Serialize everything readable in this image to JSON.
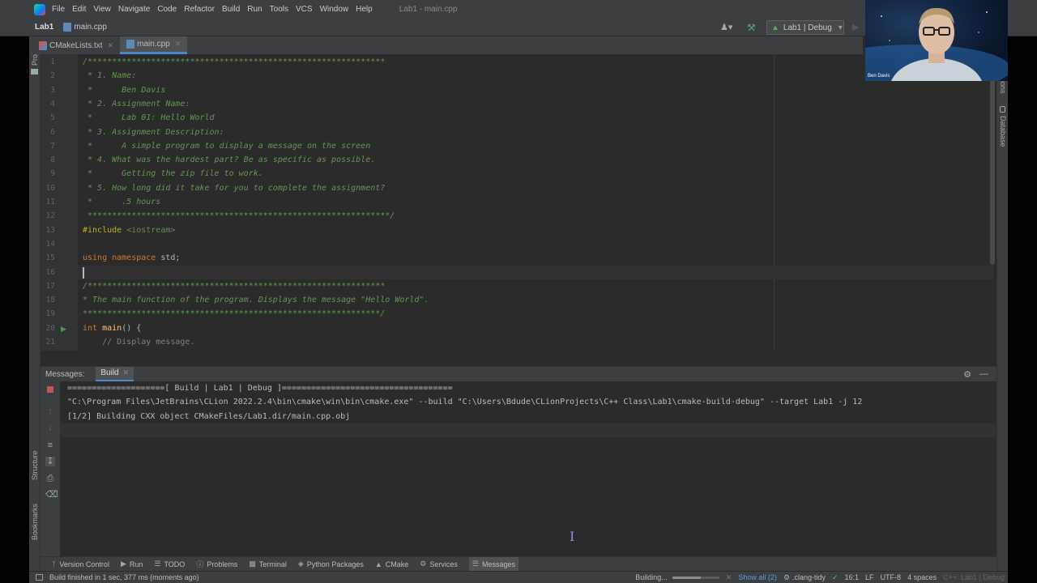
{
  "menubar": {
    "items": [
      "File",
      "Edit",
      "View",
      "Navigate",
      "Code",
      "Refactor",
      "Build",
      "Run",
      "Tools",
      "VCS",
      "Window",
      "Help"
    ],
    "window_title": "Lab1 - main.cpp"
  },
  "navbar": {
    "project": "Lab1",
    "file": "main.cpp"
  },
  "run_config": {
    "label": "Lab1 | Debug"
  },
  "tabs": [
    {
      "label": "CMakeLists.txt"
    },
    {
      "label": "main.cpp",
      "active": true
    }
  ],
  "left_stripe": {
    "project": "Project",
    "structure": "Structure",
    "bookmarks": "Bookmarks"
  },
  "right_stripe": {
    "notifications": "ions",
    "database": "Database"
  },
  "webcam": {
    "name": "Ben Davis"
  },
  "editor": {
    "lines": [
      {
        "n": "1",
        "tokens": [
          {
            "t": "/*************************************************************",
            "c": "cmt"
          }
        ]
      },
      {
        "n": "2",
        "tokens": [
          {
            "t": " * 1. Name:",
            "c": "cmt"
          }
        ]
      },
      {
        "n": "3",
        "tokens": [
          {
            "t": " *      Ben Davis",
            "c": "cmt"
          }
        ]
      },
      {
        "n": "4",
        "tokens": [
          {
            "t": " * 2. Assignment Name:",
            "c": "cmt"
          }
        ]
      },
      {
        "n": "5",
        "tokens": [
          {
            "t": " *      Lab 01: Hello World",
            "c": "cmt"
          }
        ]
      },
      {
        "n": "6",
        "tokens": [
          {
            "t": " * 3. Assignment Description:",
            "c": "cmt"
          }
        ]
      },
      {
        "n": "7",
        "tokens": [
          {
            "t": " *      A simple program to display a message on the screen",
            "c": "cmt"
          }
        ]
      },
      {
        "n": "8",
        "tokens": [
          {
            "t": " * 4. What was the hardest part? Be as specific as possible.",
            "c": "cmt"
          }
        ]
      },
      {
        "n": "9",
        "tokens": [
          {
            "t": " *      Getting the zip file to work.",
            "c": "cmt"
          }
        ]
      },
      {
        "n": "10",
        "tokens": [
          {
            "t": " * 5. How long did it take for you to complete the assignment?",
            "c": "cmt"
          }
        ]
      },
      {
        "n": "11",
        "tokens": [
          {
            "t": " *      .5 hours",
            "c": "cmt"
          }
        ]
      },
      {
        "n": "12",
        "tokens": [
          {
            "t": " **************************************************************/",
            "c": "cmt"
          }
        ]
      },
      {
        "n": "13",
        "tokens": [
          {
            "t": "#include ",
            "c": "pp"
          },
          {
            "t": "<iostream>",
            "c": "inc"
          }
        ]
      },
      {
        "n": "14",
        "tokens": []
      },
      {
        "n": "15",
        "tokens": [
          {
            "t": "using ",
            "c": "kw"
          },
          {
            "t": "namespace ",
            "c": "kw"
          },
          {
            "t": "std;",
            "c": "pl"
          }
        ]
      },
      {
        "n": "16",
        "tokens": []
      },
      {
        "n": "17",
        "tokens": [
          {
            "t": "/*************************************************************",
            "c": "cmt"
          }
        ]
      },
      {
        "n": "18",
        "tokens": [
          {
            "t": "* The main function of the program. Displays the message \"Hello World\".",
            "c": "cmt"
          }
        ]
      },
      {
        "n": "19",
        "tokens": [
          {
            "t": "*************************************************************/",
            "c": "cmt"
          }
        ]
      },
      {
        "n": "20",
        "tokens": [
          {
            "t": "int ",
            "c": "kw"
          },
          {
            "t": "main",
            "c": "fn"
          },
          {
            "t": "() {",
            "c": "pl"
          }
        ]
      },
      {
        "n": "21",
        "tokens": [
          {
            "t": "    // Display message.",
            "c": "lc"
          }
        ]
      }
    ]
  },
  "build_panel": {
    "title": "Messages:",
    "tab": "Build",
    "lines": [
      "====================[ Build | Lab1 | Debug ]===================================",
      "\"C:\\Program Files\\JetBrains\\CLion 2022.2.4\\bin\\cmake\\win\\bin\\cmake.exe\" --build \"C:\\Users\\Bdude\\CLionProjects\\C++ Class\\Lab1\\cmake-build-debug\" --target Lab1 -j 12",
      "[1/2] Building CXX object CMakeFiles/Lab1.dir/main.cpp.obj"
    ]
  },
  "tool_windows": [
    "Version Control",
    "Run",
    "TODO",
    "Problems",
    "Terminal",
    "Python Packages",
    "CMake",
    "Services",
    "Messages"
  ],
  "status": {
    "message": "Build finished in 1 sec, 377 ms (moments ago)",
    "building": "Building...",
    "progress": 0.6,
    "show_all": "Show all (2)",
    "clang_tidy": ".clang-tidy",
    "position": "16:1",
    "line_sep": "LF",
    "encoding": "UTF-8",
    "indent": "4 spaces",
    "context": "C++: Lab1 | Debug"
  }
}
